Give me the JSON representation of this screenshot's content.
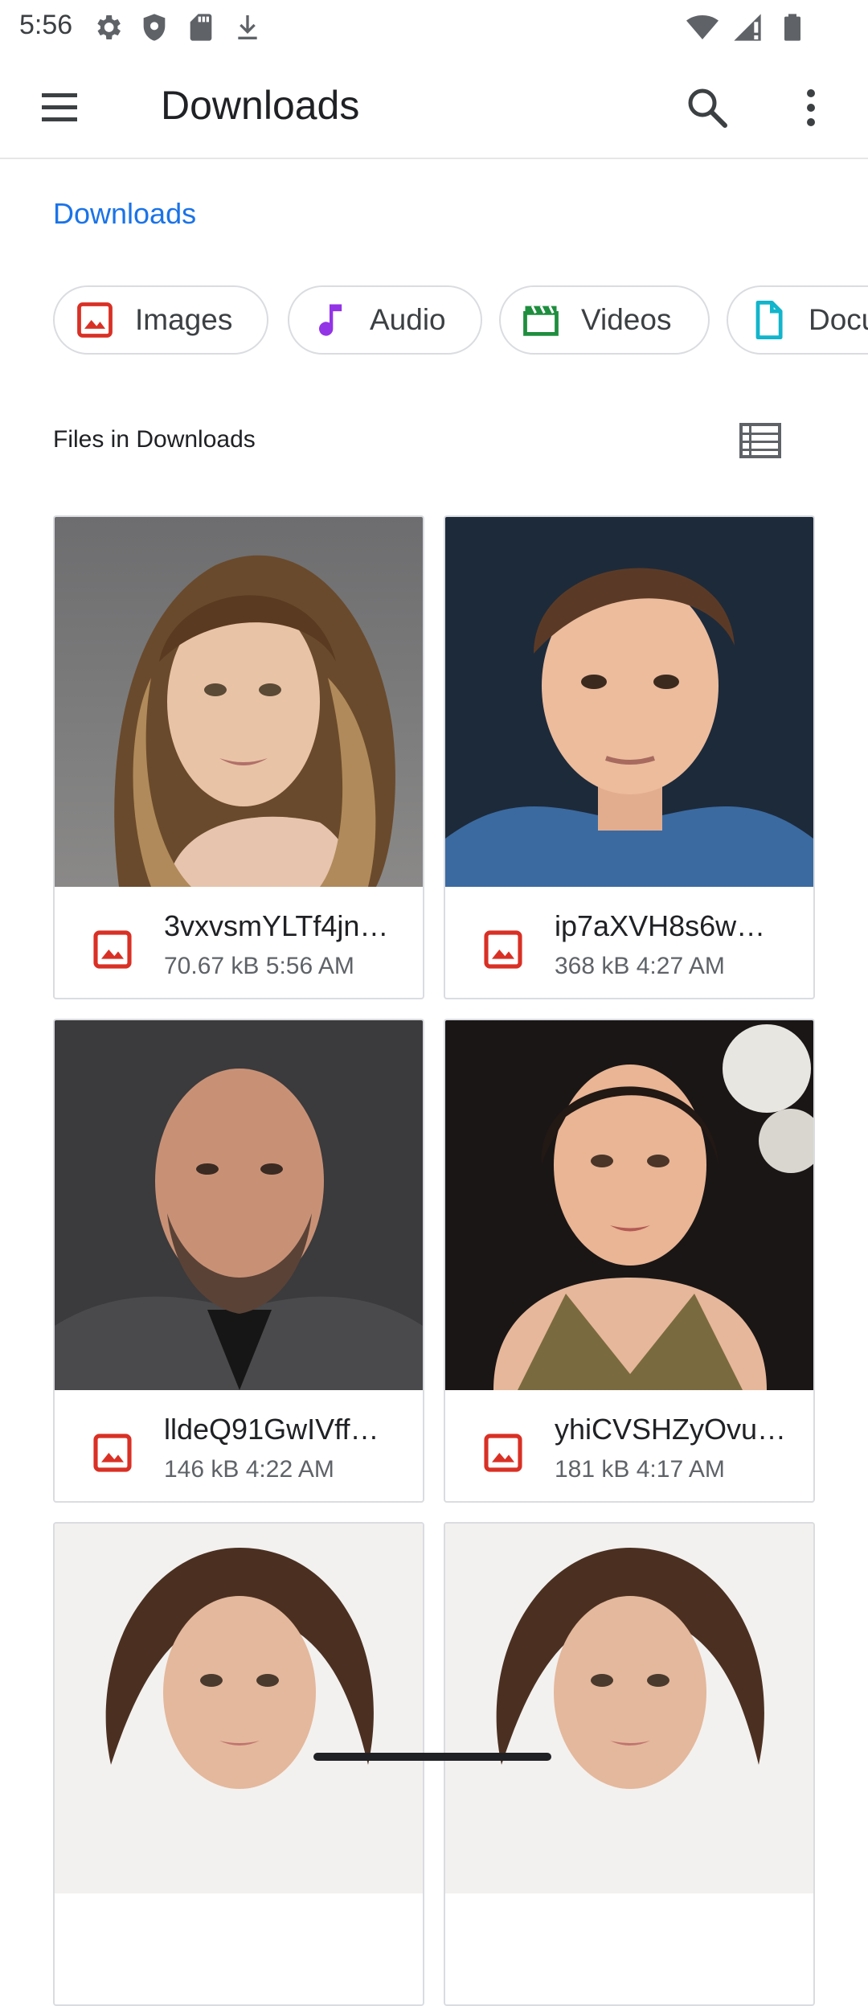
{
  "status_bar": {
    "time": "5:56",
    "left_icons": [
      "gear-icon",
      "shield-icon",
      "sd-card-icon",
      "download-icon"
    ],
    "right_icons": [
      "wifi-icon",
      "signal-icon",
      "battery-icon"
    ]
  },
  "app_bar": {
    "title": "Downloads",
    "menu_icon": "hamburger-menu-icon",
    "search_icon": "search-icon",
    "more_icon": "more-vert-icon"
  },
  "breadcrumb": {
    "label": "Downloads"
  },
  "chips": [
    {
      "label": "Images",
      "icon": "image-icon",
      "color": "#d93025"
    },
    {
      "label": "Audio",
      "icon": "music-note-icon",
      "color": "#9334e6"
    },
    {
      "label": "Videos",
      "icon": "clapperboard-icon",
      "color": "#1e8e3e"
    },
    {
      "label": "Documents",
      "icon": "document-icon",
      "color": "#12b5cb"
    }
  ],
  "section": {
    "title": "Files in Downloads",
    "view_toggle_icon": "list-view-icon"
  },
  "files": [
    {
      "name": "3vxvsmYLTf4jn…",
      "size": "70.67 kB",
      "time": "5:56 AM",
      "icon": "image-file-icon"
    },
    {
      "name": "ip7aXVH8s6w…",
      "size": "368 kB",
      "time": "4:27 AM",
      "icon": "image-file-icon"
    },
    {
      "name": "lldeQ91GwIVff…",
      "size": "146 kB",
      "time": "4:22 AM",
      "icon": "image-file-icon"
    },
    {
      "name": "yhiCVSHZyOvu…",
      "size": "181 kB",
      "time": "4:17 AM",
      "icon": "image-file-icon"
    }
  ],
  "colors": {
    "accent": "#1a73e8",
    "image_icon": "#d93025"
  }
}
